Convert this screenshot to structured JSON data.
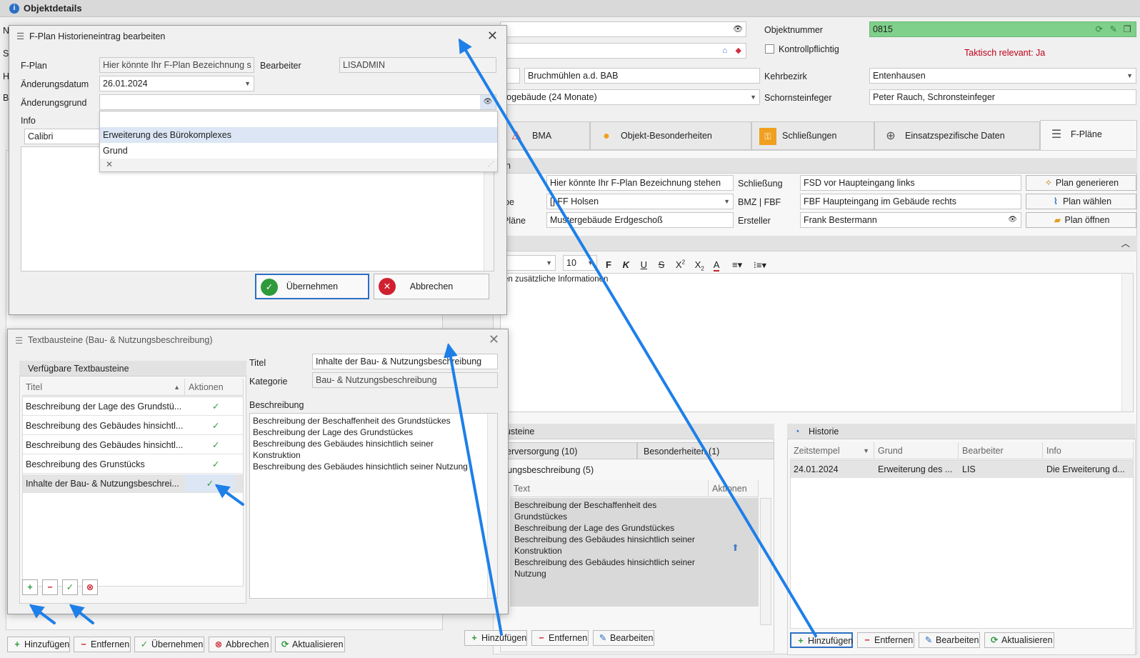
{
  "window": {
    "title": "Objektdetails"
  },
  "form": {
    "objektnummer_label": "Objektnummer",
    "objektnummer_value": "0815",
    "kontrollpflichtig_label": "Kontrollpflichtig",
    "taktisch": "Taktisch relevant: Ja",
    "ort_value": "Bruchmühlen a.d. BAB",
    "kehrbezirk_label": "Kehrbezirk",
    "kehrbezirk_value": "Entenhausen",
    "typ_value": "rogebäude  (24 Monate)",
    "schornsteinfeger_label": "Schornsteinfeger",
    "schornsteinfeger_value": "Peter Rauch, Schronsteinfeger",
    "left_letters": [
      "N",
      "S",
      "H",
      "B"
    ]
  },
  "tabs": [
    {
      "label": "BMA",
      "icon": "alarm-icon"
    },
    {
      "label": "Objekt-Besonderheiten",
      "icon": "bulb-icon"
    },
    {
      "label": "Schließungen",
      "icon": "key-icon"
    },
    {
      "label": "Einsatzspezifische Daten",
      "icon": "target-icon"
    },
    {
      "label": "F-Pläne",
      "icon": "list-icon"
    }
  ],
  "fplan": {
    "header_tail": "n",
    "bezeichnung": "Hier könnte Ihr F-Plan Bezeichnung stehen",
    "schliessung_label": "Schließung",
    "schliessung_value": "FSD  vor Haupteingang links",
    "gruppe_tail": "pe",
    "gruppe_value": "[] FF Holsen",
    "bmz_label": "BMZ | FBF",
    "bmz_value": "FBF Haupteingang im Gebäude rechts",
    "plaene_tail": "Pläne",
    "plaene_value": "Mustergebäude Erdgeschoß",
    "ersteller_label": "Ersteller",
    "ersteller_value": "Frank Bestermann",
    "btn_generate": "Plan generieren",
    "btn_choose": "Plan wählen",
    "btn_open": "Plan öffnen",
    "font_size": "10",
    "editor_text": "en zusätzliche Informationen"
  },
  "textbausteine_panel": {
    "title_tail": "usteine",
    "tab1": "erversorgung (10)",
    "tab2": "Besonderheiten (1)",
    "group": "zungsbeschreibung (5)",
    "col_text": "Text",
    "col_actions": "Aktionen",
    "content": [
      "Beschreibung der Beschaffenheit des",
      "Grundstückes",
      "Beschreibung der Lage des Grundstückes",
      "Beschreibung des Gebäudes hinsichtlich seiner",
      "Konstruktion",
      "Beschreibung des Gebäudes hinsichtlich seiner",
      "Nutzung"
    ],
    "btn_add": "Hinzufügen",
    "btn_remove": "Entfernen",
    "btn_edit": "Bearbeiten"
  },
  "historie": {
    "title": "Historie",
    "columns": [
      "Zeitstempel",
      "Grund",
      "Bearbeiter",
      "Info"
    ],
    "rows": [
      [
        "24.01.2024",
        "Erweiterung des ...",
        "LIS",
        "Die Erweiterung d..."
      ]
    ],
    "btn_add": "Hinzufügen",
    "btn_remove": "Entfernen",
    "btn_edit": "Bearbeiten",
    "btn_refresh": "Aktualisieren"
  },
  "bottom_bar": {
    "add": "Hinzufügen",
    "remove": "Entfernen",
    "accept": "Übernehmen",
    "cancel": "Abbrechen",
    "refresh": "Aktualisieren"
  },
  "dialog_history": {
    "title": "F-Plan Historieneintrag bearbeiten",
    "fplan_label": "F-Plan",
    "fplan_value": "Hier könnte Ihr F-Plan Bezeichnung s",
    "bearbeiter_label": "Bearbeiter",
    "bearbeiter_value": "LISADMIN",
    "datum_label": "Änderungsdatum",
    "datum_value": "26.01.2024",
    "grund_label": "Änderungsgrund",
    "grund_value": "",
    "info_label": "Info",
    "font": "Calibri",
    "dropdown_options": [
      "Erweiterung des Bürokomplexes",
      "Grund"
    ],
    "ok": "Übernehmen",
    "cancel": "Abbrechen"
  },
  "dialog_textbausteine": {
    "title": "Textbausteine (Bau- & Nutzungsbeschreibung)",
    "available_header": "Verfügbare Textbausteine",
    "col_title": "Titel",
    "col_actions": "Aktionen",
    "items": [
      "Beschreibung der Lage des Grundstü...",
      "Beschreibung des Gebäudes hinsichtl...",
      "Beschreibung des Gebäudes hinsichtl...",
      "Beschreibung des Grunstücks",
      "Inhalte der Bau- & Nutzungsbeschrei..."
    ],
    "titel_label": "Titel",
    "titel_value": "Inhalte der Bau- & Nutzungsbeschreibung",
    "kategorie_label": "Kategorie",
    "kategorie_value": "Bau- & Nutzungsbeschreibung",
    "beschreibung_label": "Beschreibung",
    "beschreibung_lines": [
      "Beschreibung der Beschaffenheit des Grundstückes",
      "Beschreibung der Lage des Grundstückes",
      "Beschreibung des Gebäudes hinsichtlich seiner",
      "Konstruktion",
      "Beschreibung des Gebäudes hinsichtlich seiner Nutzung"
    ]
  },
  "colors": {
    "accent_green": "#7fd08a",
    "arrow_blue": "#1e7fe8",
    "selection": "#dce6f5",
    "taktisch_red": "#c0001a"
  }
}
